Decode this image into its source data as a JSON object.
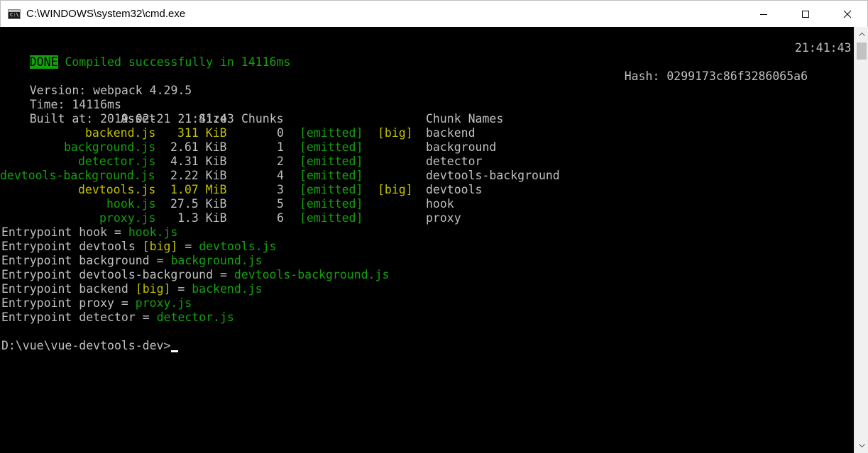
{
  "window": {
    "title": "C:\\WINDOWS\\system32\\cmd.exe",
    "icon_name": "cmd-icon",
    "icon_text": "C:\\."
  },
  "build": {
    "done_label": "DONE",
    "compiled_message": "Compiled successfully in 14116ms",
    "clock": "21:41:43",
    "hash_label": "Hash:",
    "hash_value": "0299173c86f3286065a6",
    "version_label": "Version:",
    "version_value": "webpack 4.29.5",
    "time_label": "Time:",
    "time_value": "14116ms",
    "built_label": "Built at:",
    "built_value": "2019-02-21 21:41:43"
  },
  "table": {
    "headers": {
      "asset": "Asset",
      "size": "Size",
      "chunks": "Chunks",
      "chunk_names": "Chunk Names"
    },
    "rows": [
      {
        "asset": "backend.js",
        "size": "311 KiB",
        "chunks": "0",
        "emitted": "[emitted]",
        "flag": "[big]",
        "name": "backend",
        "big": true
      },
      {
        "asset": "background.js",
        "size": "2.61 KiB",
        "chunks": "1",
        "emitted": "[emitted]",
        "flag": "",
        "name": "background",
        "big": false
      },
      {
        "asset": "detector.js",
        "size": "4.31 KiB",
        "chunks": "2",
        "emitted": "[emitted]",
        "flag": "",
        "name": "detector",
        "big": false
      },
      {
        "asset": "devtools-background.js",
        "size": "2.22 KiB",
        "chunks": "4",
        "emitted": "[emitted]",
        "flag": "",
        "name": "devtools-background",
        "big": false
      },
      {
        "asset": "devtools.js",
        "size": "1.07 MiB",
        "chunks": "3",
        "emitted": "[emitted]",
        "flag": "[big]",
        "name": "devtools",
        "big": true
      },
      {
        "asset": "hook.js",
        "size": "27.5 KiB",
        "chunks": "5",
        "emitted": "[emitted]",
        "flag": "",
        "name": "hook",
        "big": false
      },
      {
        "asset": "proxy.js",
        "size": "1.3 KiB",
        "chunks": "6",
        "emitted": "[emitted]",
        "flag": "",
        "name": "proxy",
        "big": false
      }
    ]
  },
  "entrypoints": [
    {
      "label": "Entrypoint",
      "name": "hook",
      "flag": "",
      "eq": "=",
      "file": "hook.js"
    },
    {
      "label": "Entrypoint",
      "name": "devtools",
      "flag": "[big]",
      "eq": "=",
      "file": "devtools.js"
    },
    {
      "label": "Entrypoint",
      "name": "background",
      "flag": "",
      "eq": "=",
      "file": "background.js"
    },
    {
      "label": "Entrypoint",
      "name": "devtools-background",
      "flag": "",
      "eq": "=",
      "file": "devtools-background.js"
    },
    {
      "label": "Entrypoint",
      "name": "backend",
      "flag": "[big]",
      "eq": "=",
      "file": "backend.js"
    },
    {
      "label": "Entrypoint",
      "name": "proxy",
      "flag": "",
      "eq": "=",
      "file": "proxy.js"
    },
    {
      "label": "Entrypoint",
      "name": "detector",
      "flag": "",
      "eq": "=",
      "file": "detector.js"
    }
  ],
  "prompt": {
    "text": "D:\\vue\\vue-devtools-dev>"
  },
  "colors": {
    "console_bg": "#000000",
    "text_gray": "#c0c0c0",
    "green": "#13a10e",
    "yellow": "#c1c100"
  }
}
